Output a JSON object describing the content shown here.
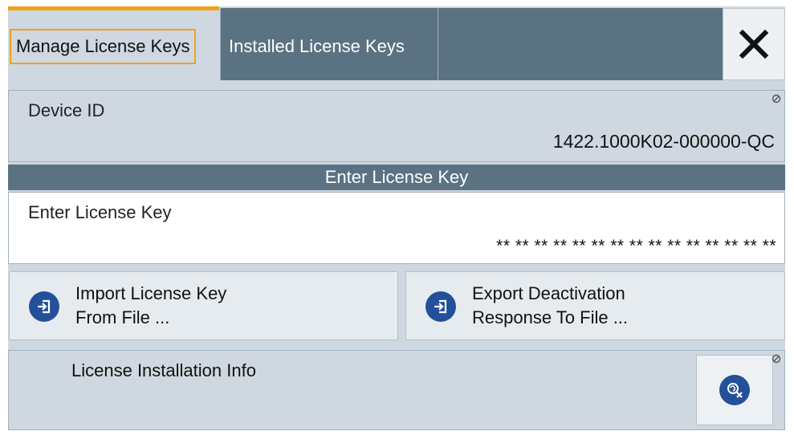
{
  "tabs": {
    "manage_label": "Manage License Keys",
    "installed_label": "Installed License Keys"
  },
  "device": {
    "label": "Device ID",
    "value": "1422.1000K02-000000-QC"
  },
  "license_section": {
    "header": "Enter License Key",
    "field_label": "Enter License Key",
    "field_value": "** ** ** ** ** ** ** ** ** ** ** ** ** ** **"
  },
  "buttons": {
    "import_line1": "Import License Key",
    "import_line2": "From File ...",
    "export_line1": "Export Deactivation",
    "export_line2": "Response To File ..."
  },
  "info": {
    "label": "License Installation Info"
  },
  "colors": {
    "accent": "#f0a11b",
    "tab_dark": "#5b7282",
    "panel": "#cfd8e0",
    "icon_blue": "#24509a"
  },
  "icons": [
    "close-icon",
    "lock-icon",
    "import-icon",
    "export-icon",
    "installation-info-icon"
  ]
}
